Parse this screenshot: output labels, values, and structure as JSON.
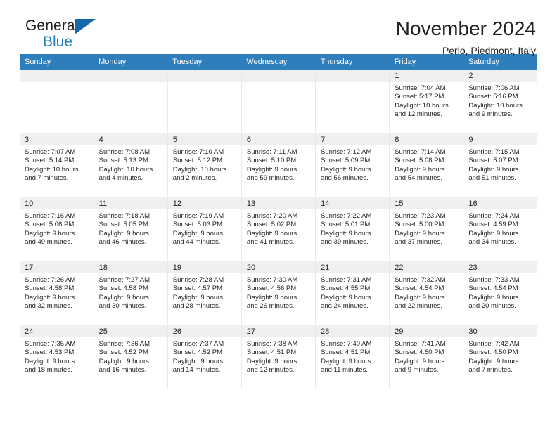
{
  "brand": {
    "name_part1": "General",
    "name_part2": "Blue",
    "logo_icon": "triangle-flag-icon"
  },
  "header": {
    "title": "November 2024",
    "location": "Perlo, Piedmont, Italy"
  },
  "calendar": {
    "weekday_headers": [
      "Sunday",
      "Monday",
      "Tuesday",
      "Wednesday",
      "Thursday",
      "Friday",
      "Saturday"
    ],
    "colors": {
      "header_blue": "#2e7ebb",
      "daynum_gray": "#efefef",
      "row_divider": "#3b7fb8",
      "brand_blue": "#1f7fc4"
    },
    "weeks": [
      [
        {
          "day": "",
          "lines": []
        },
        {
          "day": "",
          "lines": []
        },
        {
          "day": "",
          "lines": []
        },
        {
          "day": "",
          "lines": []
        },
        {
          "day": "",
          "lines": []
        },
        {
          "day": "1",
          "lines": [
            "Sunrise: 7:04 AM",
            "Sunset: 5:17 PM",
            "Daylight: 10 hours",
            "and 12 minutes."
          ]
        },
        {
          "day": "2",
          "lines": [
            "Sunrise: 7:06 AM",
            "Sunset: 5:16 PM",
            "Daylight: 10 hours",
            "and 9 minutes."
          ]
        }
      ],
      [
        {
          "day": "3",
          "lines": [
            "Sunrise: 7:07 AM",
            "Sunset: 5:14 PM",
            "Daylight: 10 hours",
            "and 7 minutes."
          ]
        },
        {
          "day": "4",
          "lines": [
            "Sunrise: 7:08 AM",
            "Sunset: 5:13 PM",
            "Daylight: 10 hours",
            "and 4 minutes."
          ]
        },
        {
          "day": "5",
          "lines": [
            "Sunrise: 7:10 AM",
            "Sunset: 5:12 PM",
            "Daylight: 10 hours",
            "and 2 minutes."
          ]
        },
        {
          "day": "6",
          "lines": [
            "Sunrise: 7:11 AM",
            "Sunset: 5:10 PM",
            "Daylight: 9 hours",
            "and 59 minutes."
          ]
        },
        {
          "day": "7",
          "lines": [
            "Sunrise: 7:12 AM",
            "Sunset: 5:09 PM",
            "Daylight: 9 hours",
            "and 56 minutes."
          ]
        },
        {
          "day": "8",
          "lines": [
            "Sunrise: 7:14 AM",
            "Sunset: 5:08 PM",
            "Daylight: 9 hours",
            "and 54 minutes."
          ]
        },
        {
          "day": "9",
          "lines": [
            "Sunrise: 7:15 AM",
            "Sunset: 5:07 PM",
            "Daylight: 9 hours",
            "and 51 minutes."
          ]
        }
      ],
      [
        {
          "day": "10",
          "lines": [
            "Sunrise: 7:16 AM",
            "Sunset: 5:06 PM",
            "Daylight: 9 hours",
            "and 49 minutes."
          ]
        },
        {
          "day": "11",
          "lines": [
            "Sunrise: 7:18 AM",
            "Sunset: 5:05 PM",
            "Daylight: 9 hours",
            "and 46 minutes."
          ]
        },
        {
          "day": "12",
          "lines": [
            "Sunrise: 7:19 AM",
            "Sunset: 5:03 PM",
            "Daylight: 9 hours",
            "and 44 minutes."
          ]
        },
        {
          "day": "13",
          "lines": [
            "Sunrise: 7:20 AM",
            "Sunset: 5:02 PM",
            "Daylight: 9 hours",
            "and 41 minutes."
          ]
        },
        {
          "day": "14",
          "lines": [
            "Sunrise: 7:22 AM",
            "Sunset: 5:01 PM",
            "Daylight: 9 hours",
            "and 39 minutes."
          ]
        },
        {
          "day": "15",
          "lines": [
            "Sunrise: 7:23 AM",
            "Sunset: 5:00 PM",
            "Daylight: 9 hours",
            "and 37 minutes."
          ]
        },
        {
          "day": "16",
          "lines": [
            "Sunrise: 7:24 AM",
            "Sunset: 4:59 PM",
            "Daylight: 9 hours",
            "and 34 minutes."
          ]
        }
      ],
      [
        {
          "day": "17",
          "lines": [
            "Sunrise: 7:26 AM",
            "Sunset: 4:58 PM",
            "Daylight: 9 hours",
            "and 32 minutes."
          ]
        },
        {
          "day": "18",
          "lines": [
            "Sunrise: 7:27 AM",
            "Sunset: 4:58 PM",
            "Daylight: 9 hours",
            "and 30 minutes."
          ]
        },
        {
          "day": "19",
          "lines": [
            "Sunrise: 7:28 AM",
            "Sunset: 4:57 PM",
            "Daylight: 9 hours",
            "and 28 minutes."
          ]
        },
        {
          "day": "20",
          "lines": [
            "Sunrise: 7:30 AM",
            "Sunset: 4:56 PM",
            "Daylight: 9 hours",
            "and 26 minutes."
          ]
        },
        {
          "day": "21",
          "lines": [
            "Sunrise: 7:31 AM",
            "Sunset: 4:55 PM",
            "Daylight: 9 hours",
            "and 24 minutes."
          ]
        },
        {
          "day": "22",
          "lines": [
            "Sunrise: 7:32 AM",
            "Sunset: 4:54 PM",
            "Daylight: 9 hours",
            "and 22 minutes."
          ]
        },
        {
          "day": "23",
          "lines": [
            "Sunrise: 7:33 AM",
            "Sunset: 4:54 PM",
            "Daylight: 9 hours",
            "and 20 minutes."
          ]
        }
      ],
      [
        {
          "day": "24",
          "lines": [
            "Sunrise: 7:35 AM",
            "Sunset: 4:53 PM",
            "Daylight: 9 hours",
            "and 18 minutes."
          ]
        },
        {
          "day": "25",
          "lines": [
            "Sunrise: 7:36 AM",
            "Sunset: 4:52 PM",
            "Daylight: 9 hours",
            "and 16 minutes."
          ]
        },
        {
          "day": "26",
          "lines": [
            "Sunrise: 7:37 AM",
            "Sunset: 4:52 PM",
            "Daylight: 9 hours",
            "and 14 minutes."
          ]
        },
        {
          "day": "27",
          "lines": [
            "Sunrise: 7:38 AM",
            "Sunset: 4:51 PM",
            "Daylight: 9 hours",
            "and 12 minutes."
          ]
        },
        {
          "day": "28",
          "lines": [
            "Sunrise: 7:40 AM",
            "Sunset: 4:51 PM",
            "Daylight: 9 hours",
            "and 11 minutes."
          ]
        },
        {
          "day": "29",
          "lines": [
            "Sunrise: 7:41 AM",
            "Sunset: 4:50 PM",
            "Daylight: 9 hours",
            "and 9 minutes."
          ]
        },
        {
          "day": "30",
          "lines": [
            "Sunrise: 7:42 AM",
            "Sunset: 4:50 PM",
            "Daylight: 9 hours",
            "and 7 minutes."
          ]
        }
      ]
    ]
  }
}
